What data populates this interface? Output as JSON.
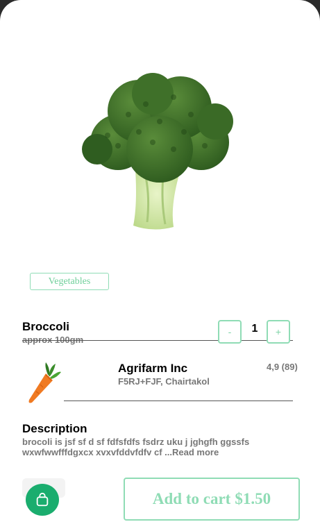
{
  "product": {
    "image_icon": "broccoli-image",
    "category": "Vegetables",
    "name": "Broccoli",
    "weight": "approx 100gm",
    "quantity": "1",
    "decrement_label": "-",
    "increment_label": "+"
  },
  "seller": {
    "avatar_icon": "carrot-image",
    "name": "Agrifarm Inc",
    "address": "F5RJ+FJF, Chairtakol",
    "rating": "4,9 (89)"
  },
  "description": {
    "heading": "Description",
    "text": "brocoli is jsf sf  d sf  fdfsfdfs fsdrz uku j jghgfh ggssfs wxwfwwfffdgxcx xvxvfddvfdfv cf ...",
    "read_more": "Read more"
  },
  "footer": {
    "cart_icon": "shopping-bag-icon",
    "add_to_cart_label": "Add to cart",
    "price": "$1.50"
  },
  "colors": {
    "accent": "#8fdcb5",
    "brand_green": "#1aad6e",
    "muted_text": "#777777"
  }
}
